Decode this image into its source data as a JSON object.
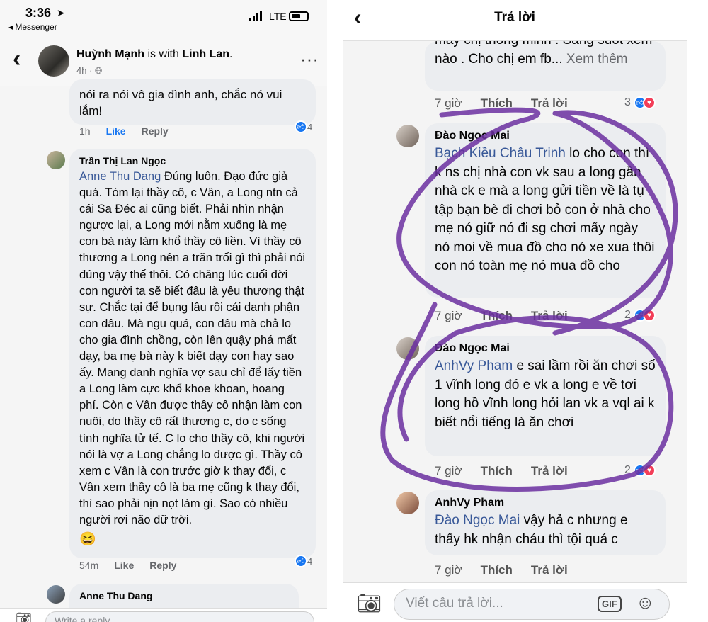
{
  "left": {
    "status": {
      "time": "3:36",
      "back_app": "◂ Messenger",
      "network": "LTE"
    },
    "header": {
      "poster": "Huỳnh Mạnh",
      "with_text": " is with ",
      "tagged": "Linh Lan",
      "period": ".",
      "time": "4h · ",
      "more": "···"
    },
    "comments": [
      {
        "text": "nói ra nói vô gia đình anh, chắc nó vui lắm!",
        "time": "1h",
        "like": "Like",
        "reply": "Reply",
        "reactions": "4"
      },
      {
        "author": "Trần Thị Lan Ngọc",
        "mention": "Anne Thu Dang",
        "text": " Đúng luôn. Đạo đức giả quá. Tóm lại thầy cô, c Vân, a Long ntn cả cái Sa Đéc ai cũng biết. Phải nhìn nhận ngược lại, a Long mới nằm xuống là mẹ con bà này làm khổ thầy cô liền. Vì thầy cô thương a Long nên a trăn trối gì thì phải nói đúng vậy thế thôi. Có chăng lúc cuối đời con người ta sẽ biết đâu là yêu thương thật sự. Chắc tại để bụng lâu rồi cái danh phận con dâu. Mà ngu quá, con dâu mà chả lo cho gia đình chồng, còn lên quậy phá mất dạy, ba mẹ bà này k biết dạy con hay sao ấy. Mang danh nghĩa vợ sau chỉ để lấy tiền a Long làm cực khổ khoe khoan, hoang phí. Còn c Vân được thầy cô nhận làm con nuôi, do thầy cô rất thương c, do c sống tình nghĩa tử tế. C lo cho thầy cô, khi người nói là vợ a Long chẳng lo được gì. Thầy cô xem c Vân là con trước giờ k thay đổi, c Vân xem thầy cô là ba mẹ cũng k thay đổi, thì sao phải nịn nọt làm gì. Sao có nhiều người rơi não dữ trời.",
        "emoji": "😆",
        "time": "54m",
        "like": "Like",
        "reply": "Reply",
        "reactions": "4"
      },
      {
        "author": "Anne Thu Dang"
      }
    ],
    "composer": {
      "placeholder": "Write a reply..."
    }
  },
  "right": {
    "title": "Trả lời",
    "comments": [
      {
        "text": "mấy chị thông minh . Sáng suốt xem nào . Cho chị em fb...",
        "see_more": " Xem thêm",
        "time": "7 giờ",
        "like": "Thích",
        "reply": "Trả lời",
        "reactions": "3"
      },
      {
        "author": "Đào Ngọc Mai",
        "mention": "Bạch Kiều Châu Trinh",
        "text": " lo cho con thì k ns chị nhà con vk sau a long gần nhà ck e mà a long gửi tiền về là tụ tập bạn bè đi chơi bỏ con ở nhà cho mẹ nó giữ nó đi sg chơi mấy ngày nó moi về mua đồ cho nó xe xua thôi con nó toàn mẹ nó mua đồ cho",
        "time": "7 giờ",
        "like": "Thích",
        "reply": "Trả lời",
        "reactions": "2"
      },
      {
        "author": "Đào Ngọc Mai",
        "mention": "AnhVy Pham",
        "text": " e sai lầm rồi ăn chơi số 1 vĩnh long đó e vk a long e về tơi long hồ vĩnh long hỏi lan vk a vql ai k biết nổi tiếng là ăn chơi",
        "time": "7 giờ",
        "like": "Thích",
        "reply": "Trả lời",
        "reactions": "2"
      },
      {
        "author": "AnhVy Pham",
        "mention": "Đào Ngọc Mai",
        "text": " vậy hả c nhưng e thấy hk nhận cháu thì tội quá c",
        "time": "7 giờ",
        "like": "Thích",
        "reply": "Trả lời"
      }
    ],
    "composer": {
      "placeholder": "Viết câu trả lời...",
      "gif": "GIF"
    }
  },
  "colors": {
    "mention": "#385898",
    "like_blue": "#1877f2",
    "love_red": "#f33e58",
    "annotation": "#6b2fa0"
  }
}
